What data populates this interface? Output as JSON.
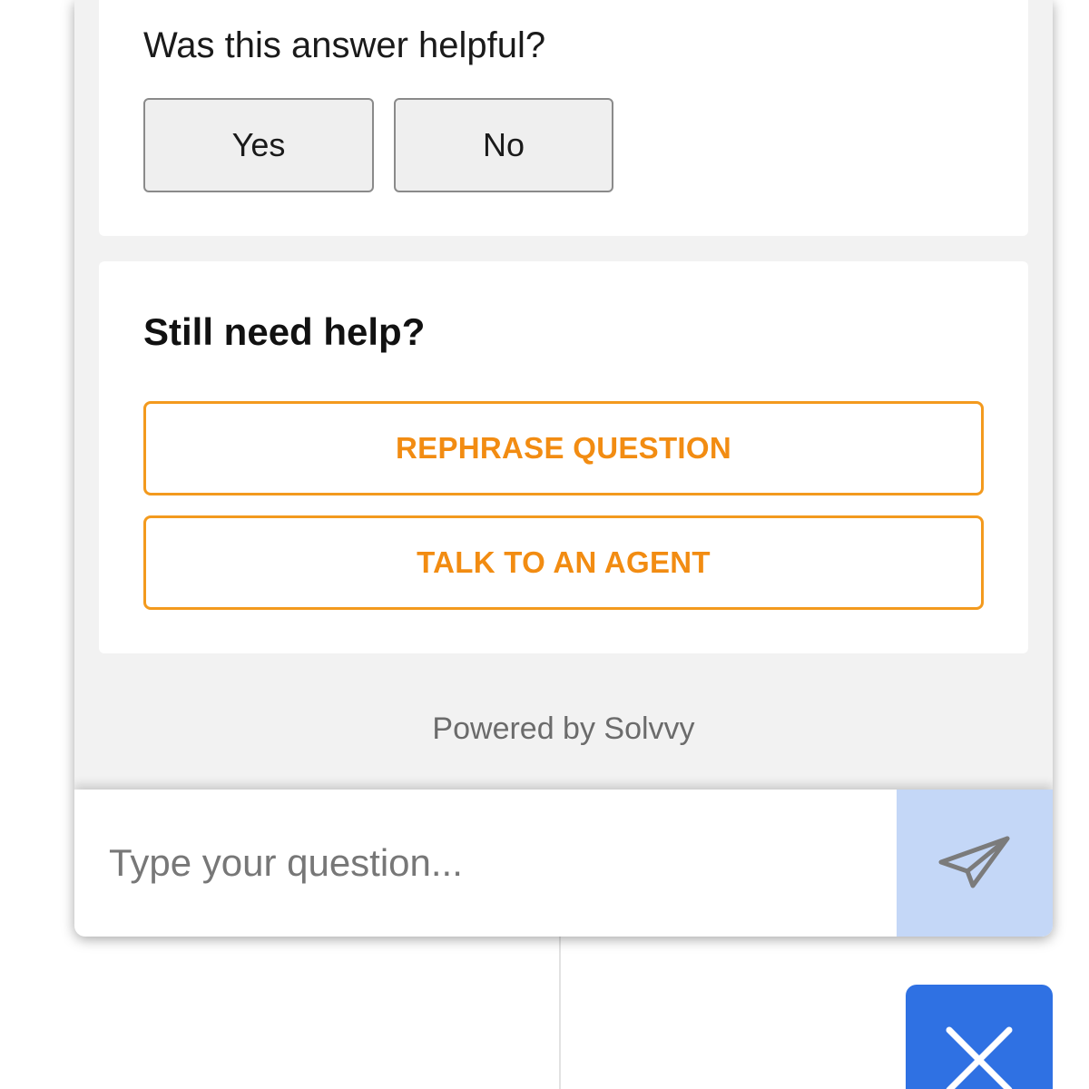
{
  "feedback": {
    "question": "Was this answer helpful?",
    "yes_label": "Yes",
    "no_label": "No"
  },
  "help": {
    "title": "Still need help?",
    "rephrase_label": "REPHRASE QUESTION",
    "agent_label": "TALK TO AN AGENT"
  },
  "footer": {
    "powered_by": "Powered by Solvvy"
  },
  "input": {
    "placeholder": "Type your question...",
    "value": ""
  },
  "icons": {
    "send": "paper-plane-icon",
    "close": "close-icon"
  },
  "colors": {
    "accent_orange": "#f28c12",
    "send_button_bg": "#c4d7f7",
    "close_button_bg": "#2f71e3",
    "widget_bg": "#f2f2f2"
  }
}
